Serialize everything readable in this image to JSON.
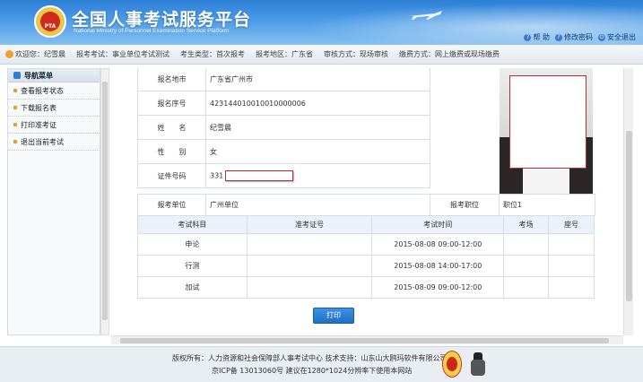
{
  "header": {
    "title": "全国人事考试服务平台",
    "subtitle": "National Ministry of Personnel Examination Service Platform",
    "logo_text": "PTA",
    "links": [
      {
        "label": "帮 助",
        "icon": "help-icon"
      },
      {
        "label": "修改密码",
        "icon": "password-icon"
      },
      {
        "label": "安全退出",
        "icon": "logout-icon"
      }
    ]
  },
  "infobar": {
    "welcome": "欢迎您：纪雪晨",
    "exam": "报考考试：事业单位考试测试",
    "candidate_type": "考生类型：首次报考",
    "region": "报考地区：广东省",
    "review": "审核方式：现场审核",
    "payment": "缴费方式：网上缴费或现场缴费"
  },
  "sidebar": {
    "title": "导航菜单",
    "items": [
      {
        "label": "查看报考状态"
      },
      {
        "label": "下载报名表"
      },
      {
        "label": "打印准考证"
      },
      {
        "label": "退出当前考试"
      }
    ]
  },
  "info": {
    "rows": [
      {
        "label": "报名地市",
        "value": "广东省广州市"
      },
      {
        "label": "报名序号",
        "value": "423144010010010000006"
      },
      {
        "label": "姓　　名",
        "value": "纪雪晨"
      },
      {
        "label": "性　　别",
        "value": "女"
      },
      {
        "label": "证件号码",
        "value": "331"
      }
    ],
    "unit_label": "报考单位",
    "unit_value": "广州单位",
    "position_label": "报考职位",
    "position_value": "职位1"
  },
  "exam_table": {
    "headers": [
      "考试科目",
      "准考证号",
      "考试时间",
      "考场",
      "座号"
    ],
    "rows": [
      {
        "subject": "申论",
        "ticket": "",
        "time": "2015-08-08 09:00-12:00",
        "room": "",
        "seat": ""
      },
      {
        "subject": "行测",
        "ticket": "",
        "time": "2015-08-08 14:00-17:00",
        "room": "",
        "seat": ""
      },
      {
        "subject": "加试",
        "ticket": "",
        "time": "2015-08-09 09:00-12:00",
        "room": "",
        "seat": ""
      }
    ]
  },
  "print_label": "打印",
  "footer": {
    "line1": "版权所有：人力资源和社会保障部人事考试中心   技术支持：山东山大鸥玛软件有限公司",
    "line2": "京ICP备 13013060号   建议在1280*1024分辨率下使用本网站"
  },
  "colors": {
    "accent": "#2d7fd6",
    "button": "#1f6fc4",
    "mask_border": "#b0312e"
  }
}
